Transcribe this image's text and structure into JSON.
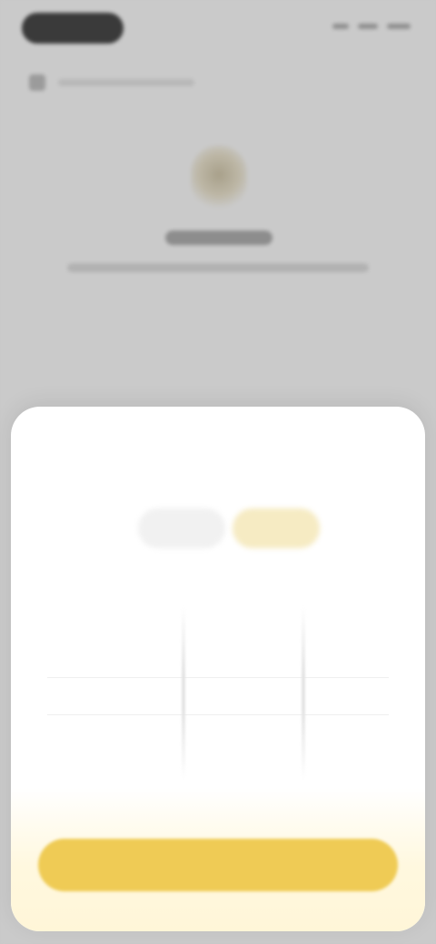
{
  "background_page": {
    "title": "",
    "subtitle": ""
  },
  "sheet": {
    "title": "",
    "segments": [
      {
        "label": "",
        "active": false
      },
      {
        "label": "",
        "active": true
      }
    ],
    "picker": {
      "column_1_value": "",
      "column_2_value": ""
    },
    "confirm_label": ""
  },
  "colors": {
    "accent": "#efcb55",
    "accent_soft": "#f6ebc3",
    "scrim": "#c9c9c9",
    "sheet_bg": "#ffffff"
  },
  "icons": {
    "hero": "badge-icon",
    "back": "back-arrow-icon"
  }
}
